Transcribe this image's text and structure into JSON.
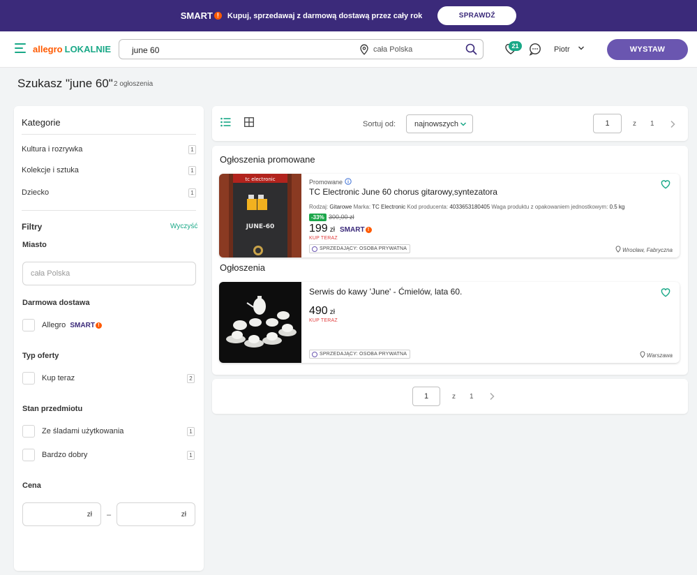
{
  "banner": {
    "smart": "SMART",
    "smart_mark": "!",
    "message": "Kupuj, sprzedawaj z darmową dostawą przez cały rok",
    "cta": "SPRAWDŹ"
  },
  "header": {
    "logo_a": "allegro",
    "logo_b": "LOKALNIE",
    "search_value": "june 60",
    "location": "cała Polska",
    "watch_count": "21",
    "user": "Piotr",
    "post_button": "WYSTAW"
  },
  "results": {
    "title": "Szukasz \"june 60\"",
    "count": "2 ogłoszenia"
  },
  "sidebar": {
    "categories_title": "Kategorie",
    "categories": [
      {
        "label": "Kultura i rozrywka",
        "count": "1"
      },
      {
        "label": "Kolekcje i sztuka",
        "count": "1"
      },
      {
        "label": "Dziecko",
        "count": "1"
      }
    ],
    "filters_title": "Filtry",
    "clear": "Wyczyść",
    "city_title": "Miasto",
    "city_placeholder": "cała Polska",
    "delivery_title": "Darmowa dostawa",
    "delivery_option": "Allegro",
    "delivery_smart": "SMART",
    "offer_type_title": "Typ oferty",
    "offer_type_option": "Kup teraz",
    "offer_type_count": "2",
    "condition_title": "Stan przedmiotu",
    "conditions": [
      {
        "label": "Ze śladami użytkowania",
        "count": "1"
      },
      {
        "label": "Bardzo dobry",
        "count": "1"
      }
    ],
    "price_title": "Cena",
    "price_currency": "zł",
    "price_separator": "–"
  },
  "toolbar": {
    "sort_label": "Sortuj od:",
    "sort_value": "najnowszych",
    "page": "1",
    "page_of": "z",
    "page_total": "1"
  },
  "listings": {
    "promoted_title": "Ogłoszenia promowane",
    "regular_title": "Ogłoszenia",
    "items": [
      {
        "promo_label": "Promowane",
        "title": "TC Electronic June 60 chorus gitarowy,syntezatora",
        "params": {
          "k1": "Rodzaj:",
          "v1": "Gitarowe",
          "k2": "Marka:",
          "v2": "TC Electronic",
          "k3": "Kod producenta:",
          "v3": "4033653180405",
          "k4": "Waga produktu z opakowaniem jednostkowym:",
          "v4": "0.5 kg"
        },
        "discount": "-33%",
        "old_price": "300,00 zł",
        "price": "199",
        "currency": "zł",
        "smart": "SMART",
        "buy_now": "KUP TERAZ",
        "seller": "SPRZEDAJĄCY: OSOBA PRYWATNA",
        "city": "Wrocław, Fabryczna",
        "image_brand": "tc electronic",
        "image_model": "JUNE-60"
      },
      {
        "title": "Serwis do kawy 'June' - Ćmielów, lata 60.",
        "price": "490",
        "currency": "zł",
        "buy_now": "KUP TERAZ",
        "seller": "SPRZEDAJĄCY: OSOBA PRYWATNA",
        "city": "Warszawa"
      }
    ]
  },
  "colors": {
    "banner": "#3b2a7a",
    "accent": "#19a887",
    "brand_orange": "#ff5a00",
    "button": "#6a56b0"
  }
}
